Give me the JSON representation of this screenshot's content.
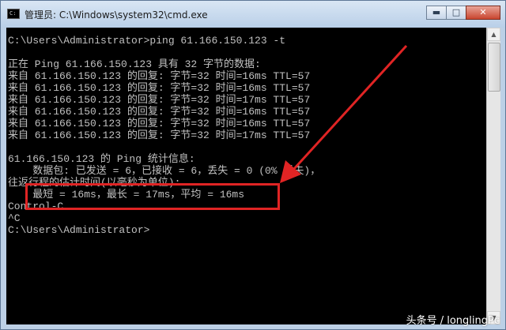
{
  "window": {
    "title": "管理员: C:\\Windows\\system32\\cmd.exe",
    "icon": "cmd-icon",
    "controls": {
      "minimize": "▬",
      "maximize": "□",
      "close": "✕"
    }
  },
  "console": {
    "lines": [
      "C:\\Users\\Administrator>ping 61.166.150.123 -t",
      "",
      "正在 Ping 61.166.150.123 具有 32 字节的数据:",
      "来自 61.166.150.123 的回复: 字节=32 时间=16ms TTL=57",
      "来自 61.166.150.123 的回复: 字节=32 时间=16ms TTL=57",
      "来自 61.166.150.123 的回复: 字节=32 时间=17ms TTL=57",
      "来自 61.166.150.123 的回复: 字节=32 时间=16ms TTL=57",
      "来自 61.166.150.123 的回复: 字节=32 时间=16ms TTL=57",
      "来自 61.166.150.123 的回复: 字节=32 时间=17ms TTL=57",
      "",
      "61.166.150.123 的 Ping 统计信息:",
      "    数据包: 已发送 = 6，已接收 = 6，丢失 = 0 (0% 丢失)，",
      "往返行程的估计时间(以毫秒为单位):",
      "    最短 = 16ms，最长 = 17ms，平均 = 16ms",
      "Control-C",
      "^C",
      "C:\\Users\\Administrator>"
    ]
  },
  "scrollbar": {
    "up_arrow": "▲",
    "down_arrow": "▼"
  },
  "colors": {
    "console_bg": "#000000",
    "console_text": "#c0c0c0",
    "annotation": "#e02424"
  },
  "watermark": "头条号 / longlingPc"
}
